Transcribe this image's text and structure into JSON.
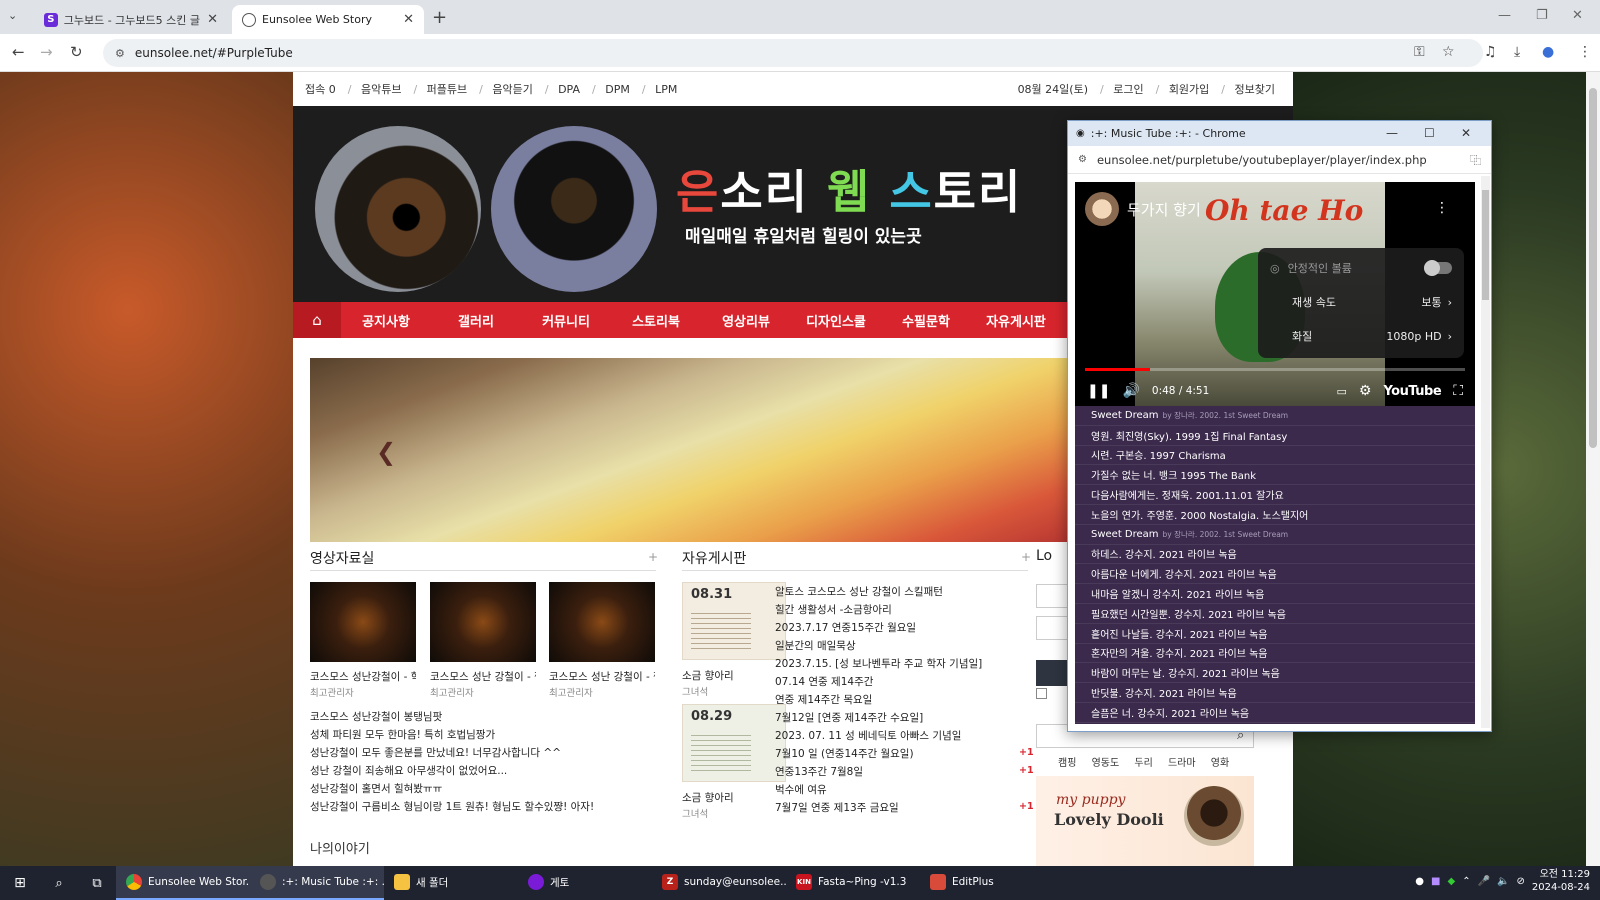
{
  "browser": {
    "tabs": [
      {
        "title": "그누보드 - 그누보드5 스킨 글 ",
        "favicon": "S",
        "active": false
      },
      {
        "title": "Eunsolee Web Story",
        "favicon": "globe",
        "active": true
      }
    ],
    "url": "eunsolee.net/#PurpleTube"
  },
  "site": {
    "topbar_left": [
      "접속 0",
      "음악튜브",
      "퍼플튜브",
      "음악듣기",
      "DPA",
      "DPM",
      "LPM"
    ],
    "topbar_right": [
      "08월 24일(토)",
      "로그인",
      "회원가입",
      "정보찾기"
    ],
    "title_parts": [
      "은",
      "소리 ",
      "웹",
      " ",
      "스",
      "토리"
    ],
    "subtitle": "매일매일 휴일처럼 힐링이 있는곳",
    "menu": [
      "공지사항",
      "갤러리",
      "커뮤니티",
      "스토리북",
      "영상리뷰",
      "디자인스쿨",
      "수필문학",
      "자유게시판"
    ],
    "video_section": {
      "title": "영상자료실",
      "thumbs": [
        {
          "title": "코스모스 성난강철이 - 학",
          "author": "최고관리자"
        },
        {
          "title": "코스모스 성난 강철이 - 짱",
          "author": "최고관리자"
        },
        {
          "title": "코스모스 성난 강철이 - 짱",
          "author": "최고관리자"
        }
      ],
      "list": [
        "코스모스 성난강철이 봉탱님팟",
        "성체 파티원 모두 한마음! 특히 호법님짱가",
        "성난강철이 모두 좋은분를 만났네요! 너무감사합니다 ^^",
        "성난 강철이 죄송해요 아무생각이 없었어요...",
        "성난강철이 홀면서 힐혀봤ㅠㅠ",
        "성난강철이 구름비소 형님이랑 1트 원츄! 형님도 할수있쨩! 아자!"
      ]
    },
    "free_board": {
      "title": "자유게시판",
      "cards": [
        {
          "date": "08.31",
          "title": "소금 향아리",
          "author": "그녀석"
        },
        {
          "date": "08.29",
          "title": "소금 향아리",
          "author": "그녀석"
        }
      ],
      "list": [
        {
          "text": "알토스 코스모스 성난 강철이 스킬패턴",
          "plus": ""
        },
        {
          "text": "힐간 생활성서 -소금항아리",
          "plus": ""
        },
        {
          "text": "2023.7.17 연중15주간 월요일",
          "plus": ""
        },
        {
          "text": "일분간의 매일묵상",
          "plus": ""
        },
        {
          "text": "2023.7.15. [성 보나벤투라 주교 학자 기념일]",
          "plus": ""
        },
        {
          "text": "07.14 연중 제14주간",
          "plus": ""
        },
        {
          "text": "연중 제14주간 목요일",
          "plus": ""
        },
        {
          "text": "7월12일 [연중 제14주간 수요일]",
          "plus": ""
        },
        {
          "text": "2023. 07. 11 성 베네딕토 아빠스 기념일",
          "plus": ""
        },
        {
          "text": "7월10 일 (연중14주간 월요일)",
          "plus": "+1"
        },
        {
          "text": "연중13주간 7월8일",
          "plus": "+1"
        },
        {
          "text": "벅수에 여유",
          "plus": ""
        },
        {
          "text": "7월7일 연중 제13주 금요일",
          "plus": "+1"
        }
      ]
    },
    "login_title": "Lo",
    "tags": [
      "캠핑",
      "영동도",
      "두리",
      "드라마",
      "영화"
    ],
    "banner": {
      "line1": "my puppy",
      "line2": "Lovely Dooli"
    },
    "story_title": "나의이야기"
  },
  "popup": {
    "window_title": ":+: Music Tube :+: - Chrome",
    "url": "eunsolee.net/purpletube/youtubeplayer/player/index.php",
    "video_title": "두가지 향기",
    "art_text": "Oh tae Ho",
    "settings": [
      {
        "label": "안정적인 볼륨",
        "value": ""
      },
      {
        "label": "재생 속도",
        "value": "보통"
      },
      {
        "label": "화질",
        "value": "1080p HD"
      }
    ],
    "time": "0:48 / 4:51",
    "progress": 0.17,
    "brand": "YouTube",
    "playlist": [
      {
        "title": "Sweet Dream",
        "meta": "by 장나라. 2002. 1st Sweet Dream"
      },
      {
        "title": "영원. 최진영(Sky). 1999 1집 Final Fantasy",
        "meta": ""
      },
      {
        "title": "시련. 구본승. 1997 Charisma",
        "meta": ""
      },
      {
        "title": "가질수 없는 너. 뱅크 1995 The Bank",
        "meta": ""
      },
      {
        "title": "다음사람에게는. 정재욱. 2001.11.01 잘가요",
        "meta": ""
      },
      {
        "title": "노을의 연가. 주영훈. 2000 Nostalgia. 노스탤지어",
        "meta": ""
      },
      {
        "title": "Sweet Dream",
        "meta": "by 장나라. 2002. 1st Sweet Dream"
      },
      {
        "title": "하데스. 강수지. 2021 라이브 녹음",
        "meta": ""
      },
      {
        "title": "아름다운 너에게. 강수지. 2021 라이브 녹음",
        "meta": ""
      },
      {
        "title": "내마음 알겠니 강수지. 2021 라이브 녹음",
        "meta": ""
      },
      {
        "title": "필요했던 시간일뿐. 강수지. 2021 라이브 녹음",
        "meta": ""
      },
      {
        "title": "흩어진 나날들. 강수지. 2021 라이브 녹음",
        "meta": ""
      },
      {
        "title": "혼자만의 겨울. 강수지. 2021 라이브 녹음",
        "meta": ""
      },
      {
        "title": "바람이 머무는 날. 강수지. 2021 라이브 녹음",
        "meta": ""
      },
      {
        "title": "반딧불. 강수지. 2021 라이브 녹음",
        "meta": ""
      },
      {
        "title": "슬픔은 너. 강수지. 2021 라이브 녹음",
        "meta": ""
      }
    ]
  },
  "taskbar": {
    "apps": [
      {
        "label": "Eunsolee Web Stor...",
        "icon": "chrome",
        "active": true
      },
      {
        "label": ":+: Music Tube :+: ...",
        "icon": "chrome",
        "active": true
      },
      {
        "label": "새 폴더",
        "icon": "folder",
        "active": false
      },
      {
        "label": "게토",
        "icon": "purple-circle",
        "active": false
      },
      {
        "label": "sunday@eunsolee....",
        "icon": "filezilla",
        "active": false
      },
      {
        "label": "Fasta~Ping -v1.3",
        "icon": "kin",
        "active": false
      },
      {
        "label": "EditPlus",
        "icon": "editplus",
        "active": false
      }
    ],
    "clock_time": "오전 11:29",
    "clock_date": "2024-08-24"
  }
}
